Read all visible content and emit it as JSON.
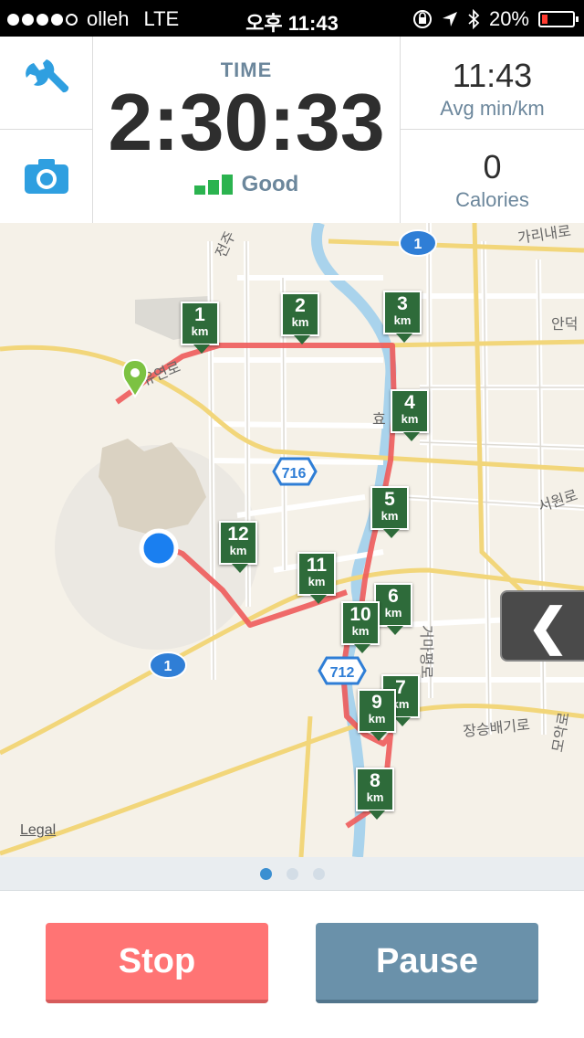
{
  "status_bar": {
    "carrier": "olleh",
    "network": "LTE",
    "time": "오후 11:43",
    "battery": "20%",
    "battery_level": 0.2
  },
  "stats": {
    "time_label": "TIME",
    "time_value": "2:30:33",
    "signal_label": "Good",
    "pace_value": "11:43",
    "pace_label": "Avg min/km",
    "calories_value": "0",
    "calories_label": "Calories"
  },
  "map": {
    "road_labels": [
      "전주",
      "가리내로",
      "안덕",
      "서원로",
      "장승배기로",
      "모악로",
      "거마평로",
      "효",
      "유연로"
    ],
    "highway_shields": [
      "1",
      "716",
      "712",
      "1"
    ],
    "km_markers": [
      {
        "n": "1",
        "u": "km"
      },
      {
        "n": "2",
        "u": "km"
      },
      {
        "n": "3",
        "u": "km"
      },
      {
        "n": "4",
        "u": "km"
      },
      {
        "n": "5",
        "u": "km"
      },
      {
        "n": "6",
        "u": "km"
      },
      {
        "n": "7",
        "u": "km"
      },
      {
        "n": "8",
        "u": "km"
      },
      {
        "n": "9",
        "u": "km"
      },
      {
        "n": "10",
        "u": "km"
      },
      {
        "n": "11",
        "u": "km"
      },
      {
        "n": "12",
        "u": "km"
      }
    ],
    "legal": "Legal",
    "collapse_glyph": "❮"
  },
  "pager": {
    "pages": 3,
    "active": 1
  },
  "buttons": {
    "stop": "Stop",
    "pause": "Pause"
  },
  "colors": {
    "accent_blue": "#2f9fe0",
    "route_red": "#ee5b5b",
    "marker_green": "#2e6b3a",
    "stop": "#ff7474",
    "pause": "#6a91aa"
  }
}
